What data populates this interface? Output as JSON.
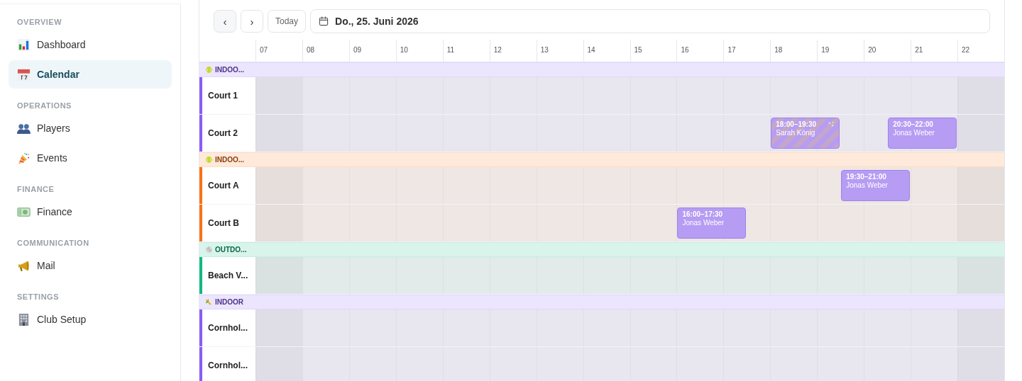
{
  "sidebar": {
    "sections": [
      {
        "title": "OVERVIEW",
        "items": [
          {
            "label": "Dashboard",
            "selected": false
          },
          {
            "label": "Calendar",
            "selected": true
          }
        ]
      },
      {
        "title": "OPERATIONS",
        "items": [
          {
            "label": "Players",
            "selected": false
          },
          {
            "label": "Events",
            "selected": false
          }
        ]
      },
      {
        "title": "FINANCE",
        "items": [
          {
            "label": "Finance",
            "selected": false
          }
        ]
      },
      {
        "title": "COMMUNICATION",
        "items": [
          {
            "label": "Mail",
            "selected": false
          }
        ]
      },
      {
        "title": "SETTINGS",
        "items": [
          {
            "label": "Club Setup",
            "selected": false
          }
        ]
      }
    ]
  },
  "toolbar": {
    "prev": "‹",
    "next": "›",
    "today": "Today",
    "date": "Do., 25. Juni 2026"
  },
  "timeline": {
    "hours": [
      {
        "label": "07",
        "closed": true
      },
      {
        "label": "08",
        "closed": false
      },
      {
        "label": "09",
        "closed": false
      },
      {
        "label": "10",
        "closed": false
      },
      {
        "label": "11",
        "closed": false
      },
      {
        "label": "12",
        "closed": false
      },
      {
        "label": "13",
        "closed": false
      },
      {
        "label": "14",
        "closed": false
      },
      {
        "label": "15",
        "closed": false
      },
      {
        "label": "16",
        "closed": false
      },
      {
        "label": "17",
        "closed": false
      },
      {
        "label": "18",
        "closed": false
      },
      {
        "label": "19",
        "closed": false
      },
      {
        "label": "20",
        "closed": false
      },
      {
        "label": "21",
        "closed": false
      },
      {
        "label": "22",
        "closed": true
      }
    ],
    "groups": [
      {
        "label": "INDOO...",
        "color": "#8b5cf6",
        "courts": [
          {
            "name": "Court 1"
          },
          {
            "name": "Court 2",
            "bookings": [
              {
                "time": "18:00–19:30",
                "player": "Sarah König",
                "striped": true
              },
              {
                "time": "20:30–22:00",
                "player": "Jonas Weber",
                "striped": false
              }
            ]
          }
        ]
      },
      {
        "label": "INDOO...",
        "color": "#f97316",
        "courts": [
          {
            "name": "Court A",
            "bookings": [
              {
                "time": "19:30–21:00",
                "player": "Jonas Weber",
                "striped": false
              }
            ]
          },
          {
            "name": "Court B",
            "bookings": [
              {
                "time": "16:00–17:30",
                "player": "Jonas Weber",
                "striped": false
              }
            ]
          }
        ]
      },
      {
        "label": "OUTDO...",
        "color": "#10b981",
        "courts": [
          {
            "name": "Beach V..."
          }
        ]
      },
      {
        "label": "INDOOR",
        "color": "#8b5cf6",
        "courts": [
          {
            "name": "Cornhol..."
          },
          {
            "name": "Cornhol..."
          }
        ]
      }
    ]
  }
}
